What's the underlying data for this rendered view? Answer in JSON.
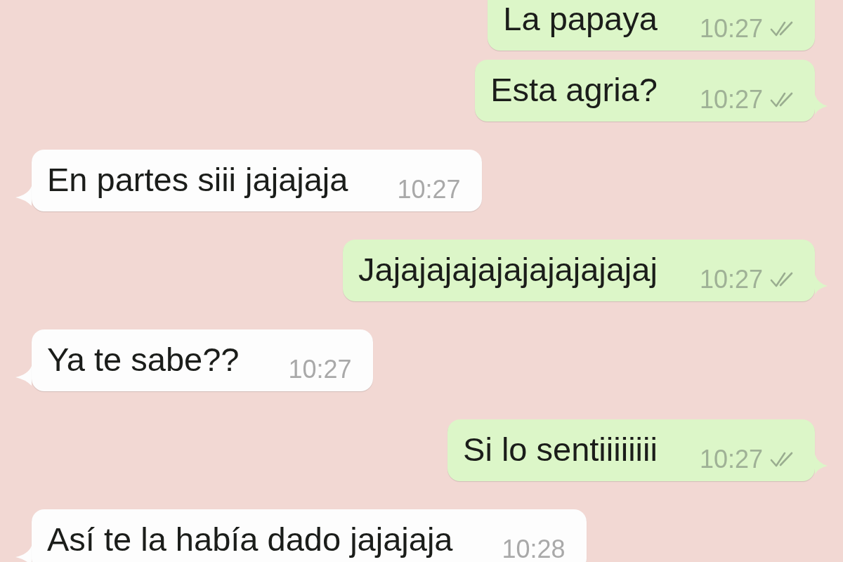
{
  "messages": [
    {
      "kind": "sent",
      "text": "La papaya",
      "time": "10:27",
      "delivered": true,
      "tail": false
    },
    {
      "kind": "sent",
      "text": "Esta agria?",
      "time": "10:27",
      "delivered": true,
      "tail": true
    },
    {
      "kind": "received",
      "text": "En partes siii jajajaja",
      "time": "10:27",
      "tail": true
    },
    {
      "kind": "sent",
      "text": "Jajajajajajajajajajajaj",
      "time": "10:27",
      "delivered": true,
      "tail": true
    },
    {
      "kind": "received",
      "text": "Ya te sabe??",
      "time": "10:27",
      "tail": true
    },
    {
      "kind": "sent",
      "text": "Si lo sentiiiiiiii",
      "time": "10:27",
      "delivered": true,
      "tail": true
    },
    {
      "kind": "received",
      "text": "Así te la había dado jajajaja",
      "time": "10:28",
      "tail": true
    }
  ]
}
